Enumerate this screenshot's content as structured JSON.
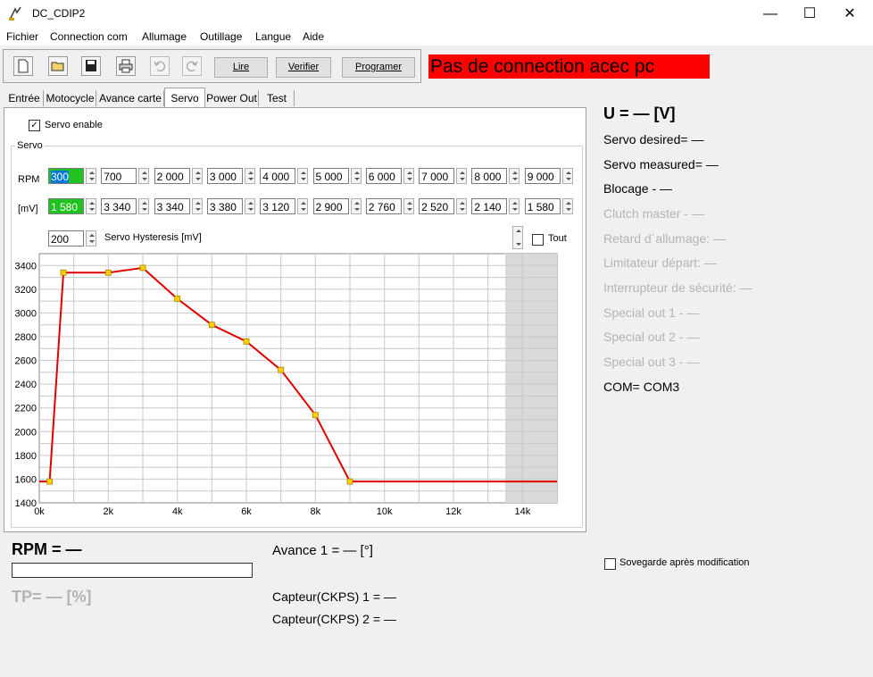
{
  "window": {
    "title": "DC_CDIP2",
    "minimize": "—",
    "maximize": "☐",
    "close": "✕"
  },
  "menu": [
    "Fichier",
    "Connection com",
    "Allumage",
    "Outillage",
    "Langue",
    "Aide"
  ],
  "toolbar": {
    "icons": [
      "new-file-icon",
      "open-folder-icon",
      "save-disk-icon",
      "print-icon",
      "undo-icon",
      "redo-icon"
    ],
    "read_label": "Lire",
    "verify_label": "Verifier",
    "program_label": "Programer"
  },
  "status_banner": "Pas de connection acec pc",
  "tabs": [
    {
      "label": "Entrée",
      "active": false
    },
    {
      "label": "Motocycle",
      "active": false
    },
    {
      "label": "Avance carte",
      "active": false
    },
    {
      "label": "Servo",
      "active": true
    },
    {
      "label": "Power Out",
      "active": false
    },
    {
      "label": "Test",
      "active": false
    }
  ],
  "servo": {
    "enable_label": "Servo enable",
    "enable_checked": true,
    "group_label": "Servo",
    "rpm_label": "RPM",
    "mv_label": "[mV]",
    "rpm_values": [
      "300",
      "700",
      "2 000",
      "3 000",
      "4 000",
      "5 000",
      "6 000",
      "7 000",
      "8 000",
      "9 000"
    ],
    "mv_values": [
      "1 580",
      "3 340",
      "3 340",
      "3 380",
      "3 120",
      "2 900",
      "2 760",
      "2 520",
      "2 140",
      "1 580"
    ],
    "hysteresis_value": "200",
    "hysteresis_label": "Servo Hysteresis [mV]",
    "tout_label": "Tout",
    "tout_checked": false
  },
  "chart_data": {
    "type": "line",
    "x": [
      0,
      300,
      700,
      2000,
      3000,
      4000,
      5000,
      6000,
      7000,
      8000,
      9000,
      15000
    ],
    "y": [
      1580,
      1580,
      3340,
      3340,
      3380,
      3120,
      2900,
      2760,
      2520,
      2140,
      1580,
      1580
    ],
    "marker_x": [
      300,
      700,
      2000,
      3000,
      4000,
      5000,
      6000,
      7000,
      8000,
      9000
    ],
    "marker_y": [
      1580,
      3340,
      3340,
      3380,
      3120,
      2900,
      2760,
      2520,
      2140,
      1580
    ],
    "xlim": [
      0,
      15000
    ],
    "ylim": [
      1400,
      3500
    ],
    "x_ticks": [
      0,
      2000,
      4000,
      6000,
      8000,
      10000,
      12000,
      14000
    ],
    "x_tick_labels": [
      "0k",
      "2k",
      "4k",
      "6k",
      "8k",
      "10k",
      "12k",
      "14k"
    ],
    "y_ticks": [
      1400,
      1600,
      1800,
      2000,
      2200,
      2400,
      2600,
      2800,
      3000,
      3200,
      3400
    ],
    "y_tick_labels": [
      "1400",
      "1600",
      "1800",
      "2000",
      "2200",
      "2400",
      "2600",
      "2800",
      "3000",
      "3200",
      "3400"
    ],
    "shaded_from_x": 13500,
    "grid": true,
    "line_color": "#e00000",
    "marker_color": "#ffd000"
  },
  "bottom": {
    "rpm": "RPM = —",
    "tp": "TP= — [%]",
    "avance": "Avance 1 = — [°]",
    "capteur1": "Capteur(CKPS) 1 = —",
    "capteur2": "Capteur(CKPS) 2 = —"
  },
  "right": {
    "voltage": "U = — [V]",
    "servo_desired": "Servo desired= —",
    "servo_measured": "Servo measured= —",
    "blocage": "Blocage - —",
    "clutch": "Clutch master - —",
    "retard": "Retard d´allumage: —",
    "limitateur": "Limitateur départ: —",
    "interrupteur": "Interrupteur de sécurité: —",
    "special1": "Special out 1 - —",
    "special2": "Special out 2 - —",
    "special3": "Special out 3 - —",
    "com": "COM= COM3",
    "save_label": "Sovegarde après modification",
    "save_checked": false
  }
}
